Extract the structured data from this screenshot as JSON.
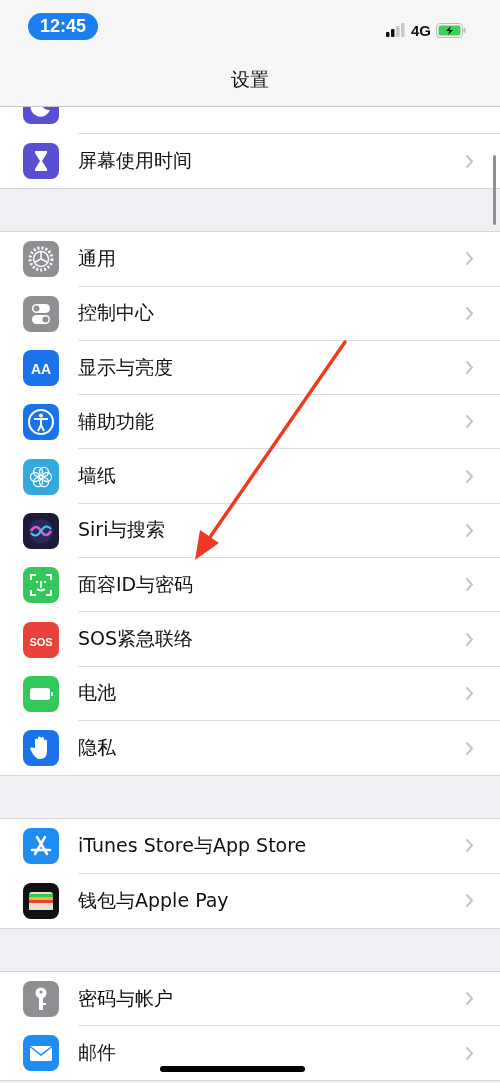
{
  "status_bar": {
    "time": "12:45",
    "network": "4G"
  },
  "nav": {
    "title": "设置"
  },
  "groups": [
    {
      "rows": [
        {
          "color": "#5b4fd1"
        },
        {
          "label": "屏幕使用时间",
          "color": "#5b4fd1"
        }
      ]
    },
    {
      "rows": [
        {
          "label": "通用",
          "color": "#8e8e93"
        },
        {
          "label": "控制中心",
          "color": "#8e8e93"
        },
        {
          "label": "显示与亮度",
          "color": "#1a73e8",
          "icon_text": "AA"
        },
        {
          "label": "辅助功能",
          "color": "#1a73e8"
        },
        {
          "label": "墙纸",
          "color": "#34aadc"
        },
        {
          "label": "Siri与搜索",
          "color": "#1c1c3a"
        },
        {
          "label": "面容ID与密码",
          "color": "#34c759"
        },
        {
          "label": "SOS紧急联络",
          "color": "#e8423a",
          "icon_text": "SOS"
        },
        {
          "label": "电池",
          "color": "#34c759"
        },
        {
          "label": "隐私",
          "color": "#1a73e8"
        }
      ]
    },
    {
      "rows": [
        {
          "label": "iTunes Store与App Store",
          "color": "#1e8cf0"
        },
        {
          "label": "钱包与Apple Pay",
          "color": "#111111"
        }
      ]
    },
    {
      "rows": [
        {
          "label": "密码与帐户",
          "color": "#8e8e93"
        },
        {
          "label": "邮件",
          "color": "#1e8cf0"
        }
      ]
    }
  ],
  "annotations": [
    {
      "kind": "arrow"
    }
  ]
}
